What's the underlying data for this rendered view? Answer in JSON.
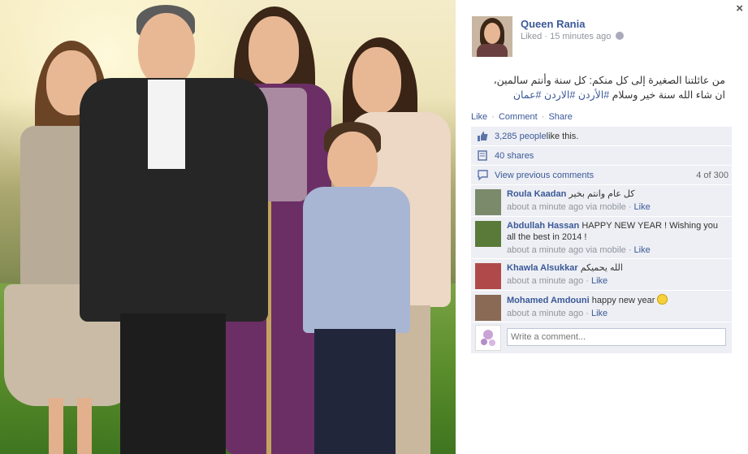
{
  "post": {
    "page_name": "Queen Rania",
    "liked": "Liked",
    "time": "15 minutes ago",
    "text_line1": "من عائلتنا الصغيرة إلى كل منكم: كل سنة وأنتم سالمين،",
    "text_line2_plain": "ان شاء الله سنة خير وسلام ",
    "hashtags": [
      "#الأردن",
      "#الاردن",
      "#عمان"
    ],
    "actions": {
      "like": "Like",
      "comment": "Comment",
      "share": "Share",
      "sep": "·"
    }
  },
  "feedback": {
    "likes_count": "3,285 people",
    "likes_suffix": " like this.",
    "shares": "40 shares",
    "view_previous": "View previous comments",
    "comment_count": "4 of 300"
  },
  "comments": [
    {
      "name": "Roula Kaadan",
      "text": "كل عام وانتم بخير",
      "time": "about a minute ago via mobile",
      "like": "Like",
      "avatar_color": "#7a8a6a"
    },
    {
      "name": "Abdullah Hassan",
      "text": "HAPPY NEW YEAR ! Wishing you all the best in 2014 !",
      "time": "about a minute ago via mobile",
      "like": "Like",
      "avatar_color": "#5a7a3a"
    },
    {
      "name": "Khawla Alsukkar",
      "text": "الله يحميكم",
      "time": "about a minute ago",
      "like": "Like",
      "avatar_color": "#b04a4a"
    },
    {
      "name": "Mohamed Amdouni",
      "text": "happy new year",
      "time": "about a minute ago",
      "like": "Like",
      "avatar_color": "#8a6a55"
    }
  ],
  "writer": {
    "placeholder": "Write a comment..."
  },
  "close_label": "×",
  "icons": {
    "close": "close-icon",
    "globe": "globe-icon",
    "like": "thumbs-up-icon",
    "share": "share-icon",
    "comment": "comment-bubble-icon",
    "smile": "smiley-icon"
  },
  "colors": {
    "link": "#3b5998",
    "panel_bg": "#edeff4",
    "muted": "#90949c"
  }
}
